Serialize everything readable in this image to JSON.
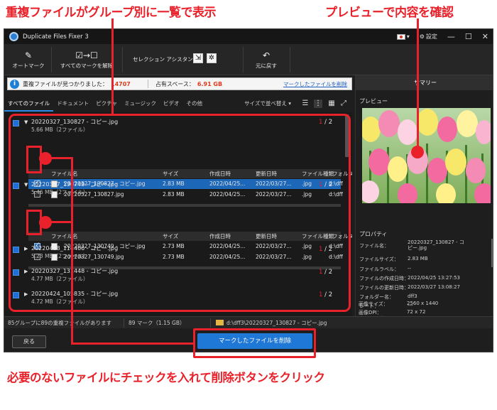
{
  "annotations": {
    "top_left": "重複ファイルがグループ別に一覧で表示",
    "top_right": "プレビューで内容を確認",
    "bottom": "必要のないファイルにチェックを入れて削除ボタンをクリック"
  },
  "window": {
    "title": "Duplicate Files Fixer 3",
    "settings_label": "設定"
  },
  "toolbar": {
    "auto_mark": "オートマーク",
    "unmark_all": "すべてのマークを解除",
    "selection_assistant": "セレクション アシスタント",
    "undo": "元に戻す"
  },
  "info": {
    "found_label": "重複ファイルが見つかりました：",
    "found_count": "14707",
    "space_label": "占有スペース：",
    "space_value": "6.91 GB",
    "delete_marked_link": "マークしたファイルを削除"
  },
  "tabs": [
    "すべてのファイル",
    "ドキュメント",
    "ピクチャ",
    "ミュージック",
    "ビデオ",
    "その他"
  ],
  "sort_label": "サイズで並べ替え",
  "columns": [
    "ファイル名",
    "サイズ",
    "作成日時",
    "更新日時",
    "ファイル種類",
    "フォルダ"
  ],
  "groups": [
    {
      "name": "20220327_130827 - コピー.jpg",
      "size": "5.66 MB（2ファイル）",
      "current": "1",
      "total": "/ 2",
      "files": [
        {
          "name": "20220327_130827 - コピー.jpg",
          "size": "2.83 MB",
          "created": "2022/04/25...",
          "modified": "2022/03/27...",
          "type": ".jpg",
          "folder": "d:\\dff",
          "checked": true,
          "selected": true
        },
        {
          "name": "20220327_130827.jpg",
          "size": "2.83 MB",
          "created": "2022/04/25...",
          "modified": "2022/03/27...",
          "type": ".jpg",
          "folder": "d:\\dff",
          "checked": false,
          "selected": false
        }
      ]
    },
    {
      "name": "20220327_130749 - コピー.jpg",
      "size": "5.46 MB（2ファイル）",
      "current": "1",
      "total": "/ 2",
      "files": [
        {
          "name": "20220327_130749 - コピー.jpg",
          "size": "2.73 MB",
          "created": "2022/04/25...",
          "modified": "2022/03/27...",
          "type": ".jpg",
          "folder": "d:\\dff",
          "checked": true,
          "selected": false
        },
        {
          "name": "20220327_130749.jpg",
          "size": "2.73 MB",
          "created": "2022/04/25...",
          "modified": "2022/03/27...",
          "type": ".jpg",
          "folder": "d:\\dff",
          "checked": false,
          "selected": false
        }
      ]
    },
    {
      "name": "20220418_114406 - コピー.jpg",
      "size": "5.23 MB（2ファイル）",
      "current": "1",
      "total": "/ 2"
    },
    {
      "name": "20220327_131448 - コピー.jpg",
      "size": "4.77 MB（2ファイル）",
      "current": "1",
      "total": "/ 2"
    },
    {
      "name": "20220424_105835 - コピー.jpg",
      "size": "4.72 MB（2ファイル）",
      "current": "1",
      "total": "/ 2"
    }
  ],
  "status": {
    "groups_summary": "85グループに89の重複ファイルがあります",
    "marked": "89 マーク（1.15 GB）",
    "path": "d:\\dff3\\20220327_130827 - コピー.jpg"
  },
  "buttons": {
    "back": "戻る",
    "delete_marked": "マークしたファイルを削除"
  },
  "summary_panel": {
    "header": "サマリー",
    "preview_label": "プレビュー",
    "properties_label": "プロパティ",
    "properties": [
      {
        "key": "ファイル名：",
        "value": "20220327_130827 - コピー.jpg"
      },
      {
        "key": "ファイルサイズ：",
        "value": "2.83 MB"
      },
      {
        "key": "ファイルラベル：",
        "value": "--"
      },
      {
        "key": "ファイルの作成日時：",
        "value": "2022/04/25 13:27:53"
      },
      {
        "key": "ファイルの更新日時：",
        "value": "2022/03/27 13:08:27"
      },
      {
        "key": "フォルダー名：",
        "value": "dff3"
      },
      {
        "key": "レート：",
        "value": "---"
      },
      {
        "key": "キーワード：",
        "value": ""
      },
      {
        "key": "画像サイズ：",
        "value": "2560 x 1440"
      },
      {
        "key": "画像DPI：",
        "value": "72 x 72"
      }
    ]
  },
  "colors": {
    "accent": "#1f78d6",
    "annotation_red": "#e8212a",
    "background": "#1e1e1e"
  }
}
